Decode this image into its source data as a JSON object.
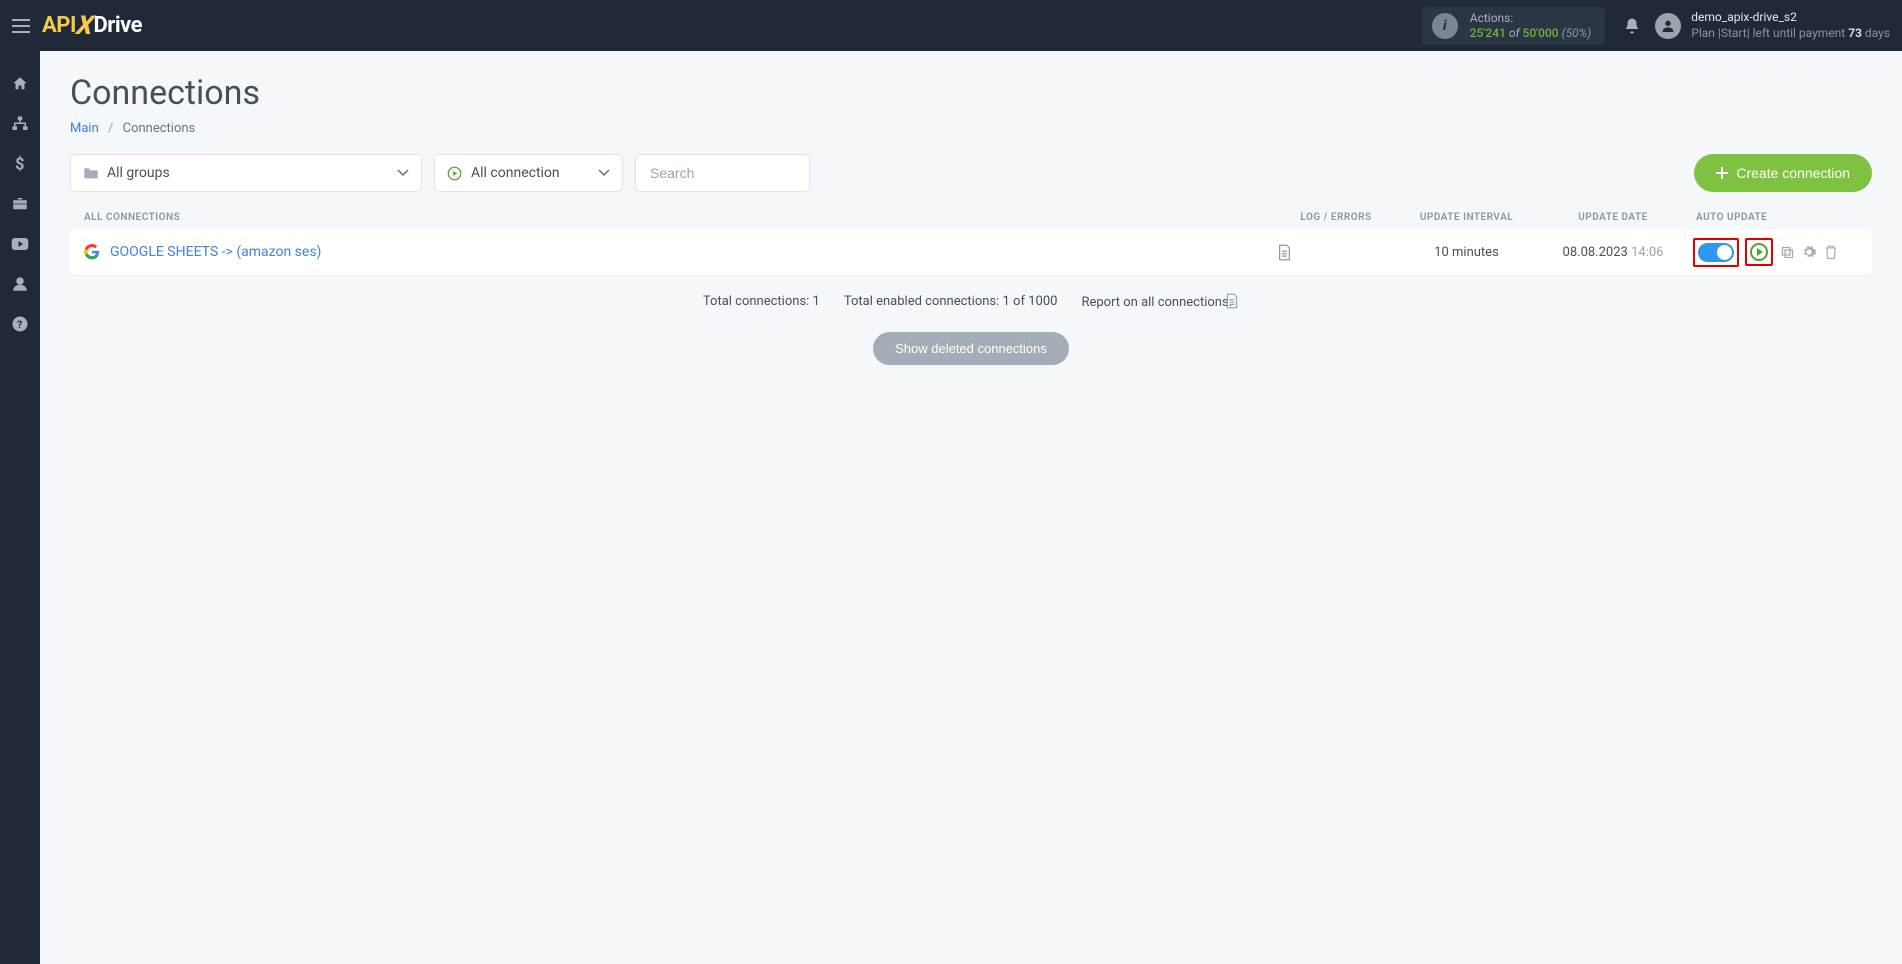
{
  "header": {
    "actions": {
      "label": "Actions:",
      "used": "25'241",
      "of": "of",
      "total": "50'000",
      "percent": "(50%)"
    },
    "user": {
      "name": "demo_apix-drive_s2",
      "plan_prefix": "Plan |Start| left until payment",
      "days_num": "73",
      "days_suffix": "days"
    }
  },
  "page": {
    "title": "Connections",
    "breadcrumb": {
      "main": "Main",
      "current": "Connections"
    }
  },
  "filters": {
    "groups": "All groups",
    "connections": "All connection",
    "search_placeholder": "Search",
    "create": "Create connection"
  },
  "table": {
    "head": {
      "all": "ALL CONNECTIONS",
      "log": "LOG / ERRORS",
      "interval": "UPDATE INTERVAL",
      "date": "UPDATE DATE",
      "auto": "AUTO UPDATE"
    },
    "rows": [
      {
        "name": "GOOGLE SHEETS -> (amazon ses)",
        "interval": "10 minutes",
        "date": "08.08.2023",
        "time": "14:06"
      }
    ]
  },
  "summary": {
    "total": "Total connections: 1",
    "enabled": "Total enabled connections: 1 of 1000",
    "report": "Report on all connections:"
  },
  "deleted_btn": "Show deleted connections"
}
